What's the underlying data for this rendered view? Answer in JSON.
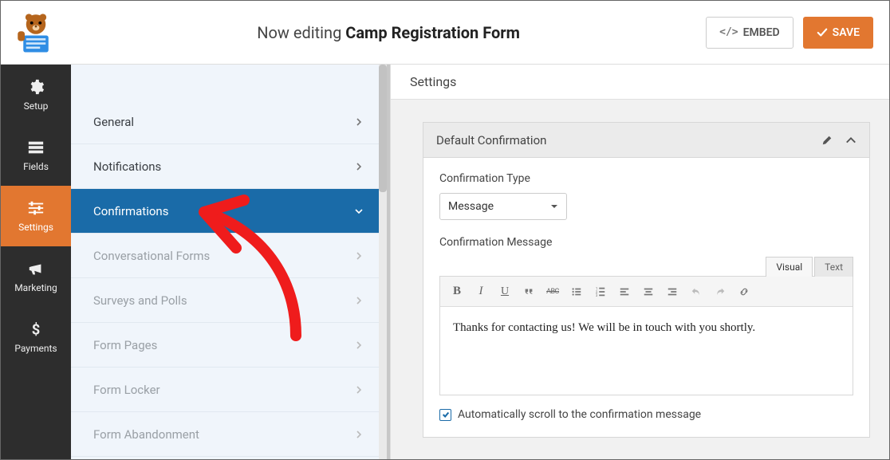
{
  "header": {
    "prefix": "Now editing ",
    "form_name": "Camp Registration Form",
    "embed_label": "EMBED",
    "save_label": "SAVE"
  },
  "vnav": {
    "setup": "Setup",
    "fields": "Fields",
    "settings": "Settings",
    "marketing": "Marketing",
    "payments": "Payments"
  },
  "submenu": {
    "general": "General",
    "notifications": "Notifications",
    "confirmations": "Confirmations",
    "conversational": "Conversational Forms",
    "surveys": "Surveys and Polls",
    "form_pages": "Form Pages",
    "form_locker": "Form Locker",
    "form_abandonment": "Form Abandonment"
  },
  "content": {
    "page_title": "Settings",
    "card_title": "Default Confirmation",
    "type_label": "Confirmation Type",
    "type_value": "Message",
    "message_label": "Confirmation Message",
    "tabs": {
      "visual": "Visual",
      "text": "Text"
    },
    "message_body": "Thanks for contacting us! We will be in touch with you shortly.",
    "auto_scroll_label": "Automatically scroll to the confirmation message",
    "auto_scroll_checked": true
  }
}
